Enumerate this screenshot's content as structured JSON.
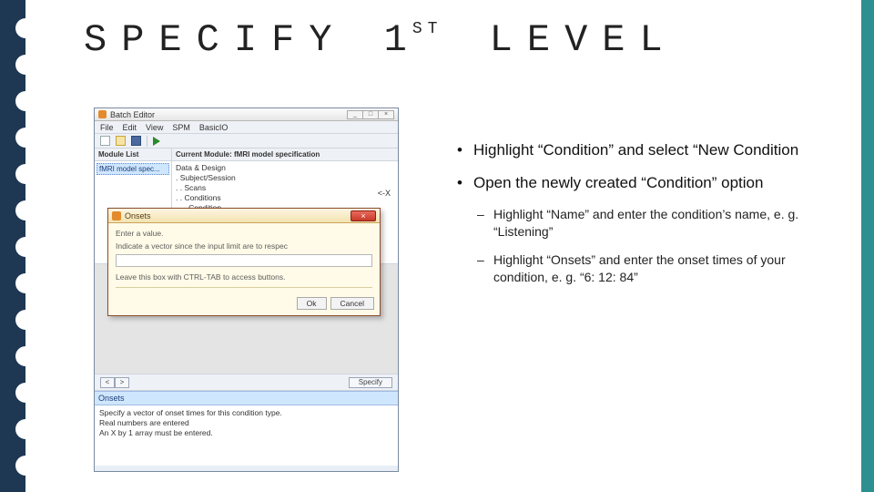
{
  "title": {
    "pre": "SPECIFY 1",
    "sup": "ST",
    "post": " LEVEL"
  },
  "shot": {
    "titlebar": "Batch Editor",
    "winbuttons": {
      "min": "_",
      "max": "□",
      "close": "×"
    },
    "menubar": [
      "File",
      "Edit",
      "View",
      "SPM",
      "BasicIO"
    ],
    "moduleList": {
      "head": "Module List",
      "item": "fMRI model spec..."
    },
    "currentModule": {
      "head": "Current Module: fMRI model specification",
      "rows": [
        "Data & Design",
        ". Subject/Session",
        ". . Scans",
        ". . Conditions",
        ". . . Condition"
      ],
      "fx": "<-X"
    },
    "nav": {
      "prev": "<",
      "next": ">"
    },
    "specify": "Specify",
    "help": {
      "head": "Onsets",
      "l1": "Specify a vector of onset times for this condition type.",
      "l2": "Real numbers are entered",
      "l3": "An X by 1 array must be entered."
    }
  },
  "dialog": {
    "title": "Onsets",
    "close": "×",
    "l1": "Enter a value.",
    "l2": "Indicate a vector since the input limit are to respec",
    "l3": "Leave this box with CTRL-TAB to access buttons.",
    "ok": "Ok",
    "cancel": "Cancel"
  },
  "notes": {
    "b1a": "Highlight “Condition” and select “New Condition",
    "b1b": "Open the newly created “Condition” option",
    "b2a": "Highlight “Name” and enter the condition’s name, e. g. “Listening”",
    "b2b": "Highlight “Onsets” and enter the onset times of your condition, e. g. “6: 12: 84”"
  }
}
